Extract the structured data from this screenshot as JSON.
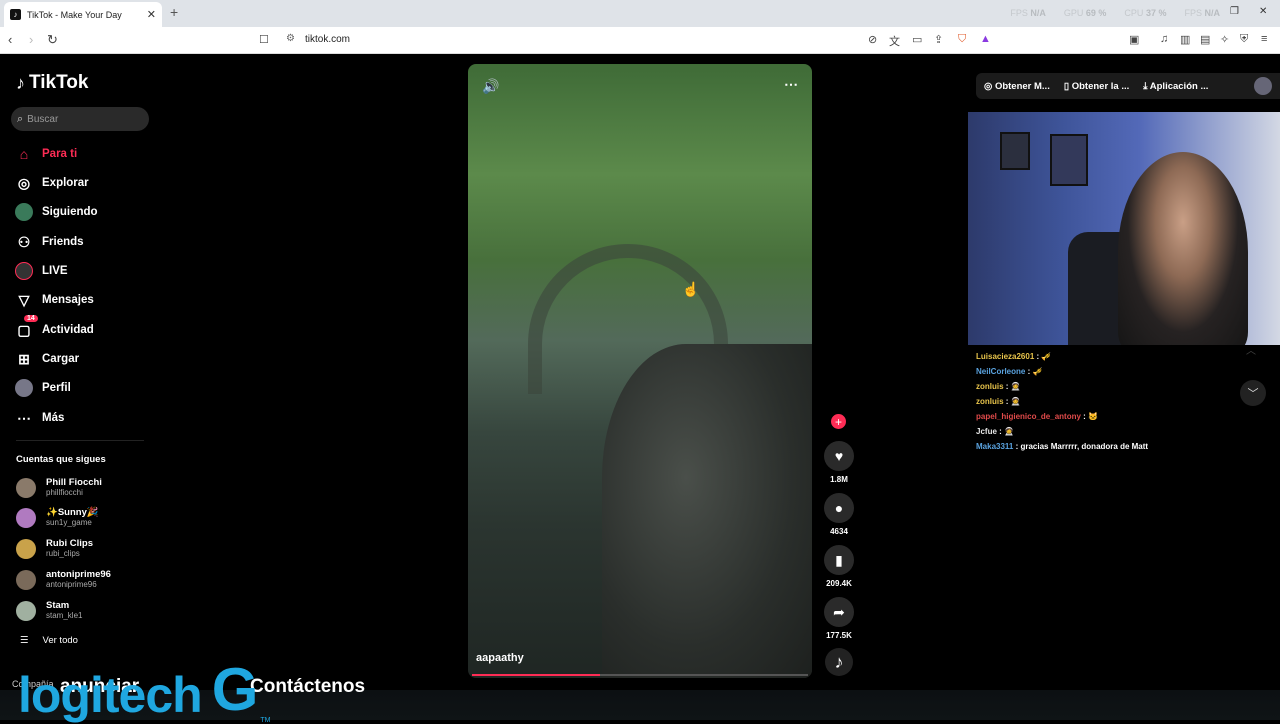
{
  "browser": {
    "tab_title": "TikTok - Make Your Day",
    "tab_close": "✕",
    "new_tab": "+",
    "url": "tiktok.com",
    "perf": [
      {
        "label": "FPS",
        "value": "N/A"
      },
      {
        "label": "GPU",
        "value": "69 %"
      },
      {
        "label": "CPU",
        "value": "37 %"
      },
      {
        "label": "FPS",
        "value": "N/A"
      }
    ]
  },
  "app": {
    "logo": "TikTok",
    "search_placeholder": "Buscar"
  },
  "nav": [
    {
      "label": "Para ti",
      "icon": "home-icon"
    },
    {
      "label": "Explorar",
      "icon": "compass-icon"
    },
    {
      "label": "Siguiendo",
      "icon": "following-avatar-icon"
    },
    {
      "label": "Friends",
      "icon": "friends-icon"
    },
    {
      "label": "LIVE",
      "icon": "live-icon"
    },
    {
      "label": "Mensajes",
      "icon": "messages-icon"
    },
    {
      "label": "Actividad",
      "icon": "activity-icon",
      "badge": "14"
    },
    {
      "label": "Cargar",
      "icon": "upload-icon"
    },
    {
      "label": "Perfil",
      "icon": "profile-icon"
    },
    {
      "label": "Más",
      "icon": "more-icon"
    }
  ],
  "following": {
    "title": "Cuentas que sigues",
    "accounts": [
      {
        "name": "Phill Fiocchi",
        "user": "phillfiocchi",
        "color": "#8a7a6a"
      },
      {
        "name": "✨Sunny🎉",
        "user": "sun1y_game",
        "color": "#b07ac0"
      },
      {
        "name": "Rubi Clips",
        "user": "rubi_clips",
        "color": "#c9a24a"
      },
      {
        "name": "antoniprime96",
        "user": "antoniprime96",
        "color": "#7a6a5a"
      },
      {
        "name": "Stam",
        "user": "stam_kle1",
        "color": "#a0b0a0"
      }
    ],
    "see_all": "Ver todo"
  },
  "video": {
    "author": "aapaathy",
    "progress": 0.38,
    "likes": "1.8M",
    "comments": "4634",
    "saves": "209.4K",
    "shares": "177.5K"
  },
  "top_right": {
    "items": [
      "Obtener M...",
      "Obtener la ...",
      "Aplicación ..."
    ]
  },
  "chat": [
    {
      "user": "Luisacieza2601",
      "msg": "🎺"
    },
    {
      "user": "NeilCorleone",
      "msg": "🎺"
    },
    {
      "user": "zonluis",
      "msg": "🧑‍🚀"
    },
    {
      "user": "zonluis",
      "msg": "🧑‍🚀"
    },
    {
      "user": "papel_higienico_de_antony",
      "msg": "🐱"
    },
    {
      "user": "Jcfue",
      "msg": "🧑‍🚀"
    },
    {
      "user": "Maka3311",
      "msg": "gracias Marrrrr, donadora de Matt"
    }
  ],
  "overlay": {
    "brand": "logitech",
    "brand_g": "G",
    "tm": "TM",
    "ghost_left": "anunciar",
    "ghost_right": "Contáctenos",
    "ghost_small": "Compañía"
  }
}
